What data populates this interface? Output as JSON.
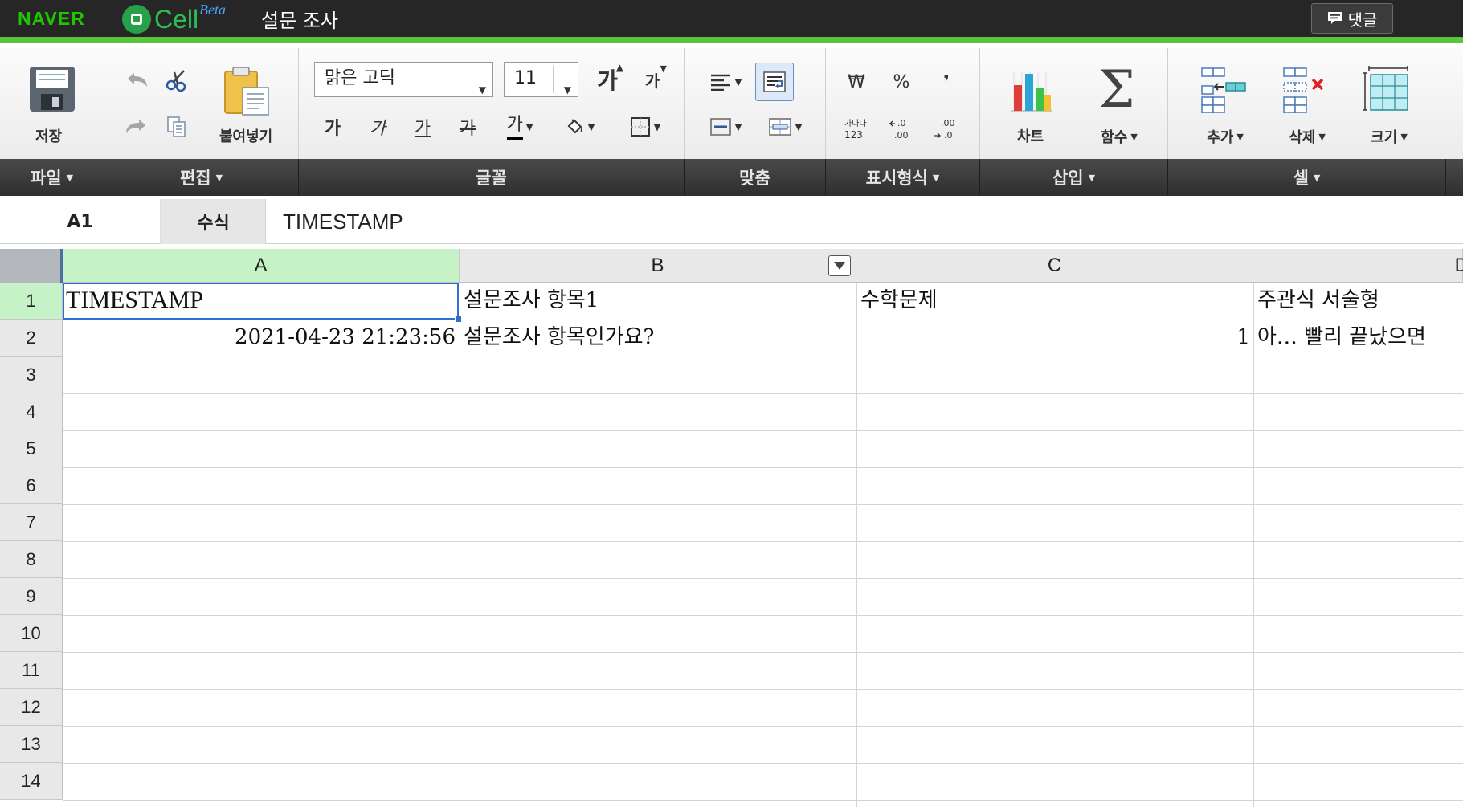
{
  "topbar": {
    "naver_logo": "NAVER",
    "app_name": "Cell",
    "beta": "Beta",
    "doc_title": "설문 조사",
    "comment_label": "댓글"
  },
  "ribbon": {
    "file": {
      "save_label": "저장",
      "group": "파일"
    },
    "edit": {
      "paste_label": "붙여넣기",
      "group": "편집"
    },
    "font": {
      "font_name": "맑은 고딕",
      "font_size": "11",
      "grow_label": "가",
      "shrink_label": "가",
      "bold_label": "가",
      "italic_label": "가",
      "underline_label": "가",
      "strike_label": "가",
      "color_label": "가",
      "group": "글꼴"
    },
    "align": {
      "group": "맞춤"
    },
    "format": {
      "won": "₩",
      "percent": "%",
      "comma": "❜",
      "group": "표시형식"
    },
    "insert": {
      "chart_label": "차트",
      "function_label": "함수",
      "group": "삽입"
    },
    "cells": {
      "add_label": "추가",
      "delete_label": "삭제",
      "size_label": "크기",
      "group": "셀"
    }
  },
  "formula_bar": {
    "cell_ref": "A1",
    "fx_label": "수식",
    "content": "TIMESTAMP"
  },
  "sheet": {
    "columns": [
      "A",
      "B",
      "C",
      "D"
    ],
    "rows": [
      "1",
      "2",
      "3",
      "4",
      "5",
      "6",
      "7",
      "8",
      "9",
      "10",
      "11",
      "12",
      "13",
      "14"
    ],
    "cells": {
      "A1": "TIMESTAMP",
      "B1": "설문조사 항목1",
      "C1": "수학문제",
      "D1": "주관식 서술형",
      "A2": "2021-04-23 21:23:56",
      "B2": "설문조사 항목인가요?",
      "C2": "1",
      "D2": "아… 빨리 끝났으면"
    }
  },
  "colors": {
    "topbar": "#262626",
    "accent_green": "#5ac53a",
    "selected_header": "#c6f2c8",
    "selection_border": "#2f6fd1"
  }
}
